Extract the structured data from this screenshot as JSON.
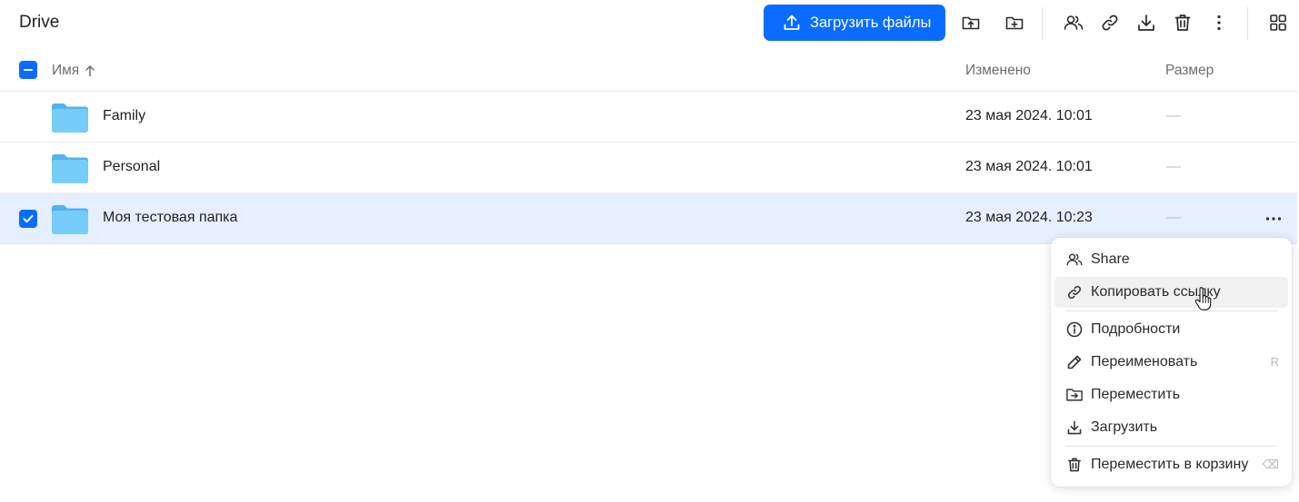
{
  "app": {
    "title": "Drive"
  },
  "toolbar": {
    "upload_label": "Загрузить файлы",
    "icons": [
      "upload-folder-icon",
      "new-folder-icon",
      "share-icon",
      "link-icon",
      "download-icon",
      "trash-icon",
      "more-vertical-icon",
      "grid-view-icon"
    ]
  },
  "table": {
    "columns": {
      "name": "Имя",
      "modified": "Изменено",
      "size": "Размер"
    },
    "sort": {
      "column": "name",
      "direction": "ascending"
    },
    "header_checkbox": "partial",
    "rows": [
      {
        "name": "Family",
        "modified": "23 мая 2024. 10:01",
        "size": "—",
        "selected": false
      },
      {
        "name": "Personal",
        "modified": "23 мая 2024. 10:01",
        "size": "—",
        "selected": false
      },
      {
        "name": "Моя тестовая папка",
        "modified": "23 мая 2024. 10:23",
        "size": "—",
        "selected": true
      }
    ]
  },
  "context_menu": {
    "items": [
      {
        "label": "Share",
        "icon": "share-icon"
      },
      {
        "label": "Копировать ссылку",
        "icon": "link-icon",
        "hovered": true
      },
      {
        "label": "Подробности",
        "icon": "info-icon"
      },
      {
        "label": "Переименовать",
        "icon": "pencil-icon",
        "shortcut": "R"
      },
      {
        "label": "Переместить",
        "icon": "move-icon"
      },
      {
        "label": "Загрузить",
        "icon": "download-icon"
      },
      {
        "label": "Переместить в корзину",
        "icon": "trash-icon",
        "shortcut": "⌫"
      }
    ]
  },
  "colors": {
    "accent": "#0a6cff",
    "selected_row": "#e6efff",
    "folder": "#6cc5f7"
  }
}
